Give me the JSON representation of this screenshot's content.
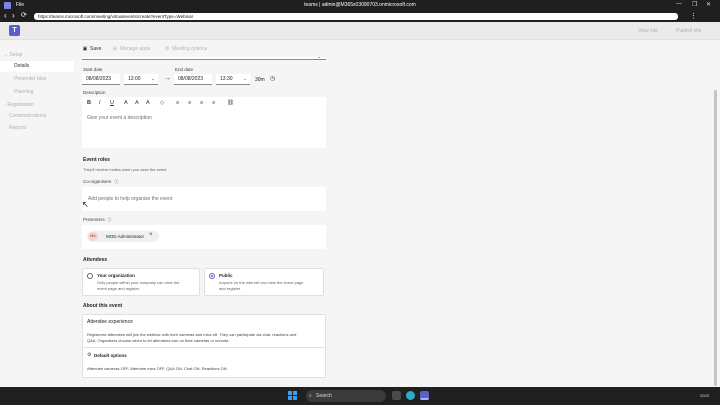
{
  "window": {
    "menu_file": "File",
    "title": "teams | admin@M365x03090703.onmicrosoft.com",
    "minimize": "—",
    "restore": "❐",
    "close": "✕"
  },
  "browser": {
    "url": "https://teams.microsoft.com/meeting/virtualevents/create?eventType=Webinar",
    "back": "‹",
    "forward": "›",
    "refresh": "⟳",
    "more": "⋮"
  },
  "appbar": {
    "logo_letter": "T",
    "view_site": "View site",
    "publish_site": "Publish site"
  },
  "sidebar": {
    "items": [
      {
        "label": "Setup",
        "chevron": "⌄"
      },
      {
        "label": "Details"
      },
      {
        "label": "Presenter bios"
      },
      {
        "label": "Planning"
      },
      {
        "label": "Registration",
        "chevron": "›"
      },
      {
        "label": "Communications"
      },
      {
        "label": "Reports"
      }
    ]
  },
  "toolbar": {
    "save": "Save",
    "manage_apps": "Manage apps",
    "meeting_options": "Meeting options"
  },
  "form": {
    "start_date_label": "Start date",
    "start_date": "08/08/2023",
    "start_time": "13:00",
    "end_date_label": "End date",
    "end_date": "08/08/2023",
    "end_time": "13:30",
    "duration": "30m",
    "description_label": "Description",
    "description_placeholder": "Give your event a description",
    "rte_buttons": [
      "B",
      "I",
      "U",
      "A",
      "A",
      "A",
      "◇",
      "≡",
      "≡",
      "≡",
      "≡",
      "⛓"
    ],
    "event_roles_title": "Event roles",
    "event_roles_note": "They'll receive invites when you save the event.",
    "coorganisers_label": "Co-organisers",
    "coorganisers_placeholder": "Add people to help organise the event",
    "presenters_label": "Presenters",
    "presenter": {
      "initials": "MA",
      "name": "MOD Administrator"
    },
    "attendees_title": "Attendees",
    "attendee_options": [
      {
        "title": "Your organization",
        "desc_line1": "Only people within your company can view the",
        "desc_line2": "event page and register.",
        "selected": false
      },
      {
        "title": "Public",
        "desc_line1": "Anyone on the internet can view the event page",
        "desc_line2": "and register.",
        "selected": true
      }
    ],
    "about_title": "About this event",
    "experience_title": "Attendee experience",
    "experience_line1": "Registered attendees will join the webinar with their cameras and mics off. They can participate via chat, reactions and",
    "experience_line2": "Q&A. Organisers choose when to let attendees turn on their cameras or unmute.",
    "default_options_title": "Default options",
    "default_options_text": "Attendee cameras OFF, Attendee mics OFF, Q&A ON, Chat ON, Reactions ON"
  },
  "taskbar": {
    "search": "Search",
    "clock": "2023"
  }
}
